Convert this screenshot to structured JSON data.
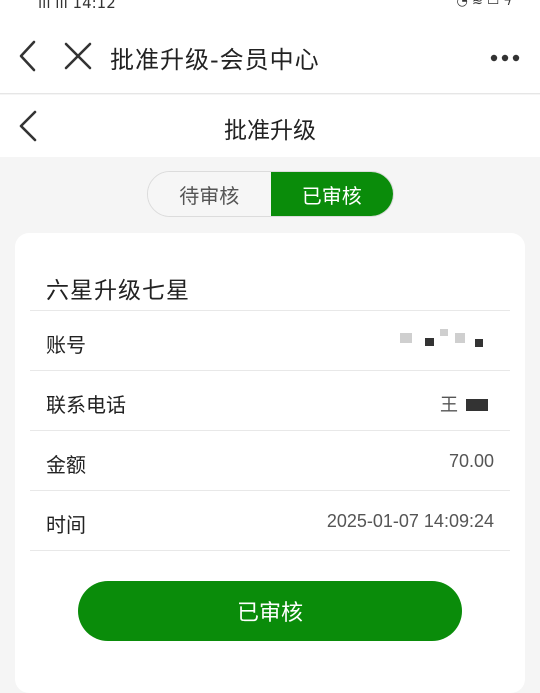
{
  "status_bar": {
    "left": "ևևև 14:12",
    "right": "●"
  },
  "navbar": {
    "title": "批准升级-会员中心"
  },
  "page": {
    "title": "批准升级"
  },
  "tabs": [
    {
      "label": "待审核",
      "active": false
    },
    {
      "label": "已审核",
      "active": true
    }
  ],
  "card": {
    "title": "六星升级七星",
    "rows": [
      {
        "label": "账号",
        "value": ""
      },
      {
        "label": "联系电话",
        "value": "王"
      },
      {
        "label": "金额",
        "value": "70.00"
      },
      {
        "label": "时间",
        "value": "2025-01-07 14:09:24"
      }
    ],
    "button_label": "已审核"
  },
  "colors": {
    "accent": "#0a8c0a",
    "background": "#f5f5f5"
  }
}
